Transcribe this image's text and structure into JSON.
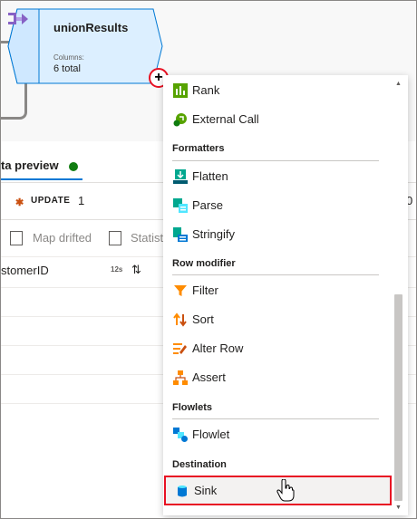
{
  "node": {
    "title": "unionResults",
    "columns_label": "Columns:",
    "columns_value": "6 total"
  },
  "add_button_symbol": "+",
  "preview": {
    "tab_label": "ta preview",
    "status_color": "#107c10",
    "update_label": "UPDATE",
    "update_count": "1",
    "right_count": "0",
    "toolbar": {
      "map_drifted": "Map drifted",
      "statistics": "Statist"
    },
    "column": {
      "name": "stomerID",
      "type_tag": "12s",
      "sort_symbol": "⇅"
    }
  },
  "menu": {
    "items_top": [
      {
        "label": "Rank",
        "icon": "rank-icon"
      },
      {
        "label": "External Call",
        "icon": "external-call-icon"
      }
    ],
    "sections": [
      {
        "header": "Formatters",
        "items": [
          {
            "label": "Flatten",
            "icon": "flatten-icon"
          },
          {
            "label": "Parse",
            "icon": "parse-icon"
          },
          {
            "label": "Stringify",
            "icon": "stringify-icon"
          }
        ]
      },
      {
        "header": "Row modifier",
        "items": [
          {
            "label": "Filter",
            "icon": "filter-icon"
          },
          {
            "label": "Sort",
            "icon": "sort-icon"
          },
          {
            "label": "Alter Row",
            "icon": "alter-row-icon"
          },
          {
            "label": "Assert",
            "icon": "assert-icon"
          }
        ]
      },
      {
        "header": "Flowlets",
        "items": [
          {
            "label": "Flowlet",
            "icon": "flowlet-icon"
          }
        ]
      },
      {
        "header": "Destination",
        "items": [
          {
            "label": "Sink",
            "icon": "sink-icon",
            "highlighted": true
          }
        ]
      }
    ]
  },
  "colors": {
    "accent": "#0078d4",
    "highlight_border": "#e81123",
    "node_fill": "#dcefff"
  }
}
